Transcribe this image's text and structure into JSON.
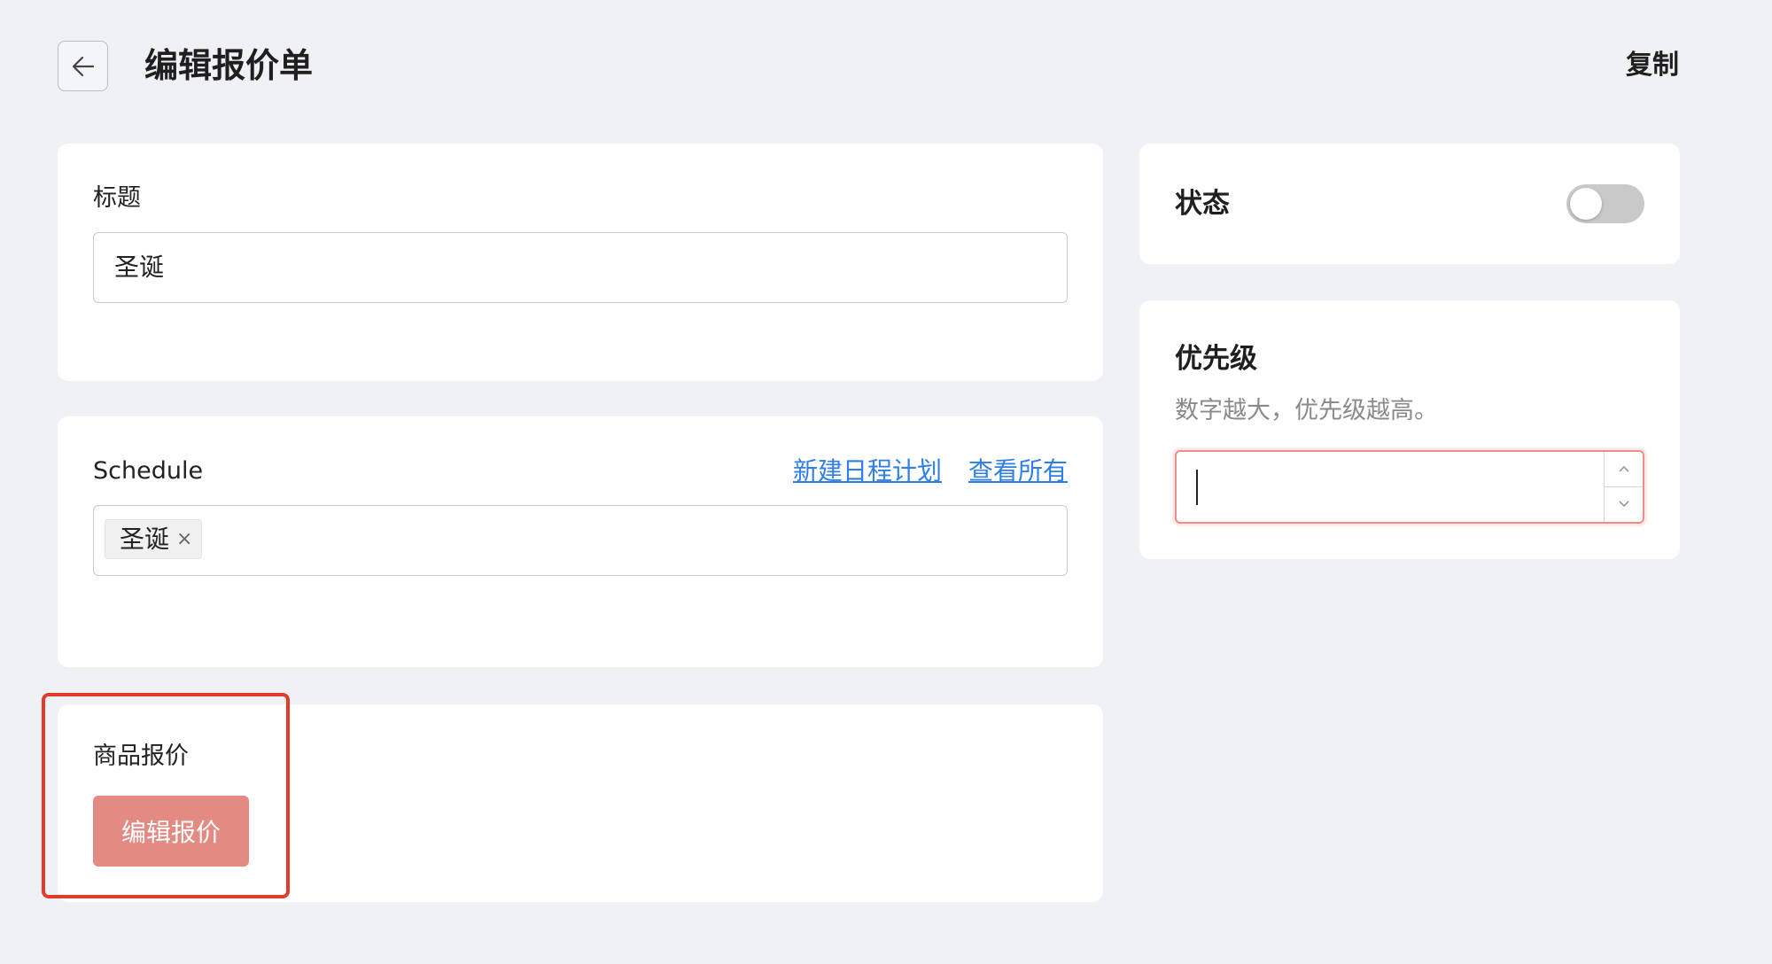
{
  "header": {
    "title": "编辑报价单",
    "copy_label": "复制"
  },
  "title_card": {
    "label": "标题",
    "value": "圣诞"
  },
  "schedule_card": {
    "label": "Schedule",
    "new_schedule_link": "新建日程计划",
    "view_all_link": "查看所有",
    "tags": [
      {
        "label": "圣诞",
        "close": "×"
      }
    ]
  },
  "products_card": {
    "label": "商品报价",
    "edit_button": "编辑报价"
  },
  "status_card": {
    "label": "状态",
    "enabled": false
  },
  "priority_card": {
    "label": "优先级",
    "hint": "数字越大，优先级越高。",
    "value": ""
  },
  "colors": {
    "accent": "#e38b83",
    "link": "#2f7fe6",
    "highlight": "#e33a2a",
    "background": "#f0f1f5"
  },
  "icons": {
    "back": "arrow-left-icon",
    "tag_close": "close-icon",
    "step_up": "chevron-up-icon",
    "step_down": "chevron-down-icon"
  }
}
